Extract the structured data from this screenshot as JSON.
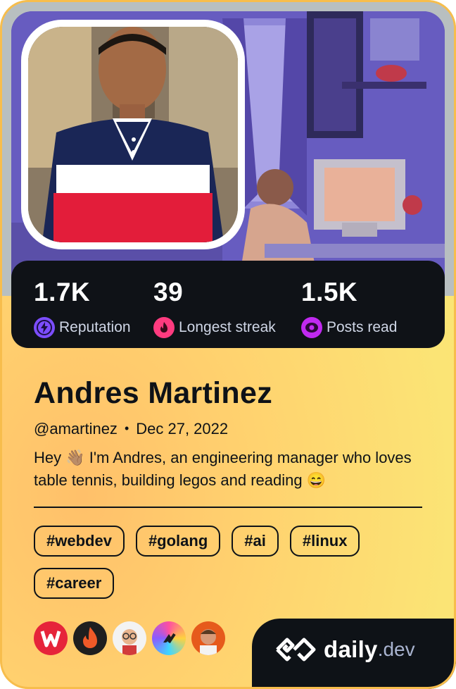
{
  "profile": {
    "name": "Andres Martinez",
    "handle": "@amartinez",
    "date": "Dec 27, 2022",
    "bio": "Hey 👋🏽 I'm Andres, an engineering manager who loves table tennis, building legos and reading 😄"
  },
  "stats": [
    {
      "value": "1.7K",
      "label": "Reputation",
      "icon": "reputation-icon",
      "color": "#7c4dff"
    },
    {
      "value": "39",
      "label": "Longest streak",
      "icon": "streak-flame-icon",
      "color": "#ff3b7f"
    },
    {
      "value": "1.5K",
      "label": "Posts read",
      "icon": "posts-read-icon",
      "color": "#c029f0"
    }
  ],
  "tags": [
    "#webdev",
    "#golang",
    "#ai",
    "#linux",
    "#career"
  ],
  "sources": [
    {
      "name": "W logo source",
      "icon": "w-logo-icon",
      "color": "#e6243a"
    },
    {
      "name": "fire logo source",
      "icon": "fire-logo-icon",
      "color": "#f05a28"
    },
    {
      "name": "nerd avatar source",
      "icon": "nerd-avatar-icon",
      "color": "#f3f3f3"
    },
    {
      "name": "rainbow logo source",
      "icon": "rainbow-logo-icon",
      "color": "#ff4fa0"
    },
    {
      "name": "man avatar source",
      "icon": "man-avatar-icon",
      "color": "#e65a1c"
    }
  ],
  "brand": {
    "daily": "daily",
    "dev": ".dev"
  },
  "colors": {
    "card_yellow": "#fbe475",
    "dark": "#0e1217",
    "accent_orange": "#ffc06a"
  }
}
